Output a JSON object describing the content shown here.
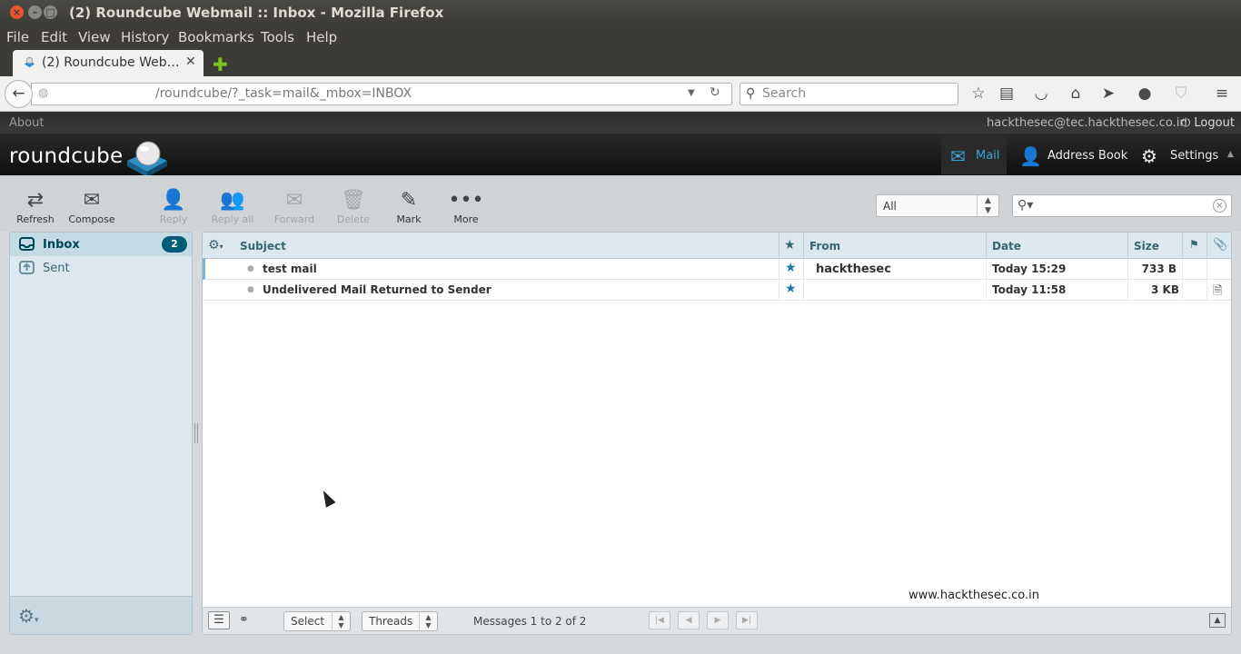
{
  "window": {
    "title": "(2) Roundcube Webmail :: Inbox - Mozilla Firefox"
  },
  "menu": [
    "File",
    "Edit",
    "View",
    "History",
    "Bookmarks",
    "Tools",
    "Help"
  ],
  "tab": {
    "title": "(2) Roundcube Web…"
  },
  "nav": {
    "url": "/roundcube/?_task=mail&_mbox=INBOX",
    "search_placeholder": "Search"
  },
  "rc_topbar": {
    "about": "About",
    "user": "hackthesec@tec.hackthesec.co.in",
    "logout": "Logout"
  },
  "brand": {
    "logo_text": "roundcube"
  },
  "taskbar": {
    "mail": "Mail",
    "address_book": "Address Book",
    "settings": "Settings"
  },
  "toolbar": {
    "refresh": "Refresh",
    "compose": "Compose",
    "reply": "Reply",
    "reply_all": "Reply all",
    "forward": "Forward",
    "delete": "Delete",
    "mark": "Mark",
    "more": "More"
  },
  "filter": {
    "value": "All"
  },
  "folders": [
    {
      "name": "Inbox",
      "unread": "2",
      "selected": true
    },
    {
      "name": "Sent",
      "unread": "",
      "selected": false
    }
  ],
  "list_columns": {
    "subject": "Subject",
    "from": "From",
    "date": "Date",
    "size": "Size"
  },
  "messages": [
    {
      "subject": "test mail",
      "from": "hackthesec",
      "date": "Today 15:29",
      "size": "733 B",
      "attachment": false
    },
    {
      "subject": "Undelivered Mail Returned to Sender",
      "from": "",
      "date": "Today 11:58",
      "size": "3 KB",
      "attachment": true
    }
  ],
  "list_footer": {
    "select": "Select",
    "threads": "Threads",
    "count": "Messages 1 to 2 of 2"
  },
  "watermark": "www.hackthesec.co.in",
  "colors": {
    "accent": "#1978a8",
    "badge": "#005d76"
  }
}
